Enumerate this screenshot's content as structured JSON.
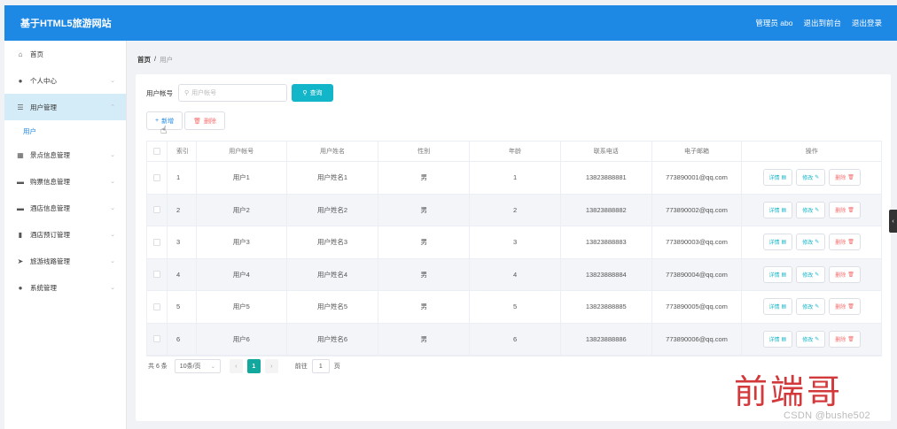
{
  "header": {
    "brand": "基于HTML5旅游网站",
    "admin": "管理员 abo",
    "back_to_console": "退出到前台",
    "logout": "退出登录"
  },
  "sidebar": {
    "items": [
      {
        "label": "首页",
        "icon": "home-icon",
        "glyph": "⌂"
      },
      {
        "label": "个人中心",
        "icon": "person-icon",
        "glyph": "●",
        "chevron": "⌄"
      },
      {
        "label": "用户管理",
        "icon": "list-icon",
        "glyph": "☰",
        "chevron": "⌃"
      },
      {
        "label": "景点信息管理",
        "icon": "grid-icon",
        "glyph": "▦",
        "chevron": "⌄"
      },
      {
        "label": "购票信息管理",
        "icon": "ticket-icon",
        "glyph": "▬",
        "chevron": "⌄"
      },
      {
        "label": "酒店信息管理",
        "icon": "hotel-icon",
        "glyph": "▬",
        "chevron": "⌄"
      },
      {
        "label": "酒店预订管理",
        "icon": "bar-chart-icon",
        "glyph": "▮",
        "chevron": "⌄"
      },
      {
        "label": "旅游线路管理",
        "icon": "send-icon",
        "glyph": "➤",
        "chevron": "⌄"
      },
      {
        "label": "系统管理",
        "icon": "person-icon",
        "glyph": "●",
        "chevron": "⌄"
      }
    ],
    "sub_item": "用户"
  },
  "breadcrumb": {
    "home": "首页",
    "sep": "/",
    "current": "用户"
  },
  "search": {
    "label": "用户帐号",
    "placeholder": "用户帐号",
    "icon": "search-icon",
    "button": "查询"
  },
  "actions": {
    "add": "新增",
    "delete": "删除"
  },
  "table": {
    "headers": [
      "索引",
      "用户帐号",
      "用户姓名",
      "性别",
      "年龄",
      "联系电话",
      "电子邮箱",
      "操作"
    ],
    "rows": [
      {
        "index": "1",
        "account": "用户1",
        "name": "用户姓名1",
        "gender": "男",
        "age": "1",
        "phone": "13823888881",
        "email": "773890001@qq.com"
      },
      {
        "index": "2",
        "account": "用户2",
        "name": "用户姓名2",
        "gender": "男",
        "age": "2",
        "phone": "13823888882",
        "email": "773890002@qq.com"
      },
      {
        "index": "3",
        "account": "用户3",
        "name": "用户姓名3",
        "gender": "男",
        "age": "3",
        "phone": "13823888883",
        "email": "773890003@qq.com"
      },
      {
        "index": "4",
        "account": "用户4",
        "name": "用户姓名4",
        "gender": "男",
        "age": "4",
        "phone": "13823888884",
        "email": "773890004@qq.com"
      },
      {
        "index": "5",
        "account": "用户5",
        "name": "用户姓名5",
        "gender": "男",
        "age": "5",
        "phone": "13823888885",
        "email": "773890005@qq.com"
      },
      {
        "index": "6",
        "account": "用户6",
        "name": "用户姓名6",
        "gender": "男",
        "age": "6",
        "phone": "13823888886",
        "email": "773890006@qq.com"
      }
    ],
    "ops": {
      "detail": "详情",
      "edit": "修改",
      "remove": "删除"
    }
  },
  "pager": {
    "total": "共 6 条",
    "page_size": "10条/页",
    "current_page": "1",
    "goto_prefix": "前往",
    "goto_value": "1",
    "goto_suffix": "页"
  },
  "watermark": {
    "cn": "前端哥",
    "en": "CSDN @bushe502"
  },
  "colors": {
    "header": "#1e88e5",
    "accent": "#13b5c8",
    "danger": "#f56c6c",
    "pager_active": "#13a89e"
  }
}
